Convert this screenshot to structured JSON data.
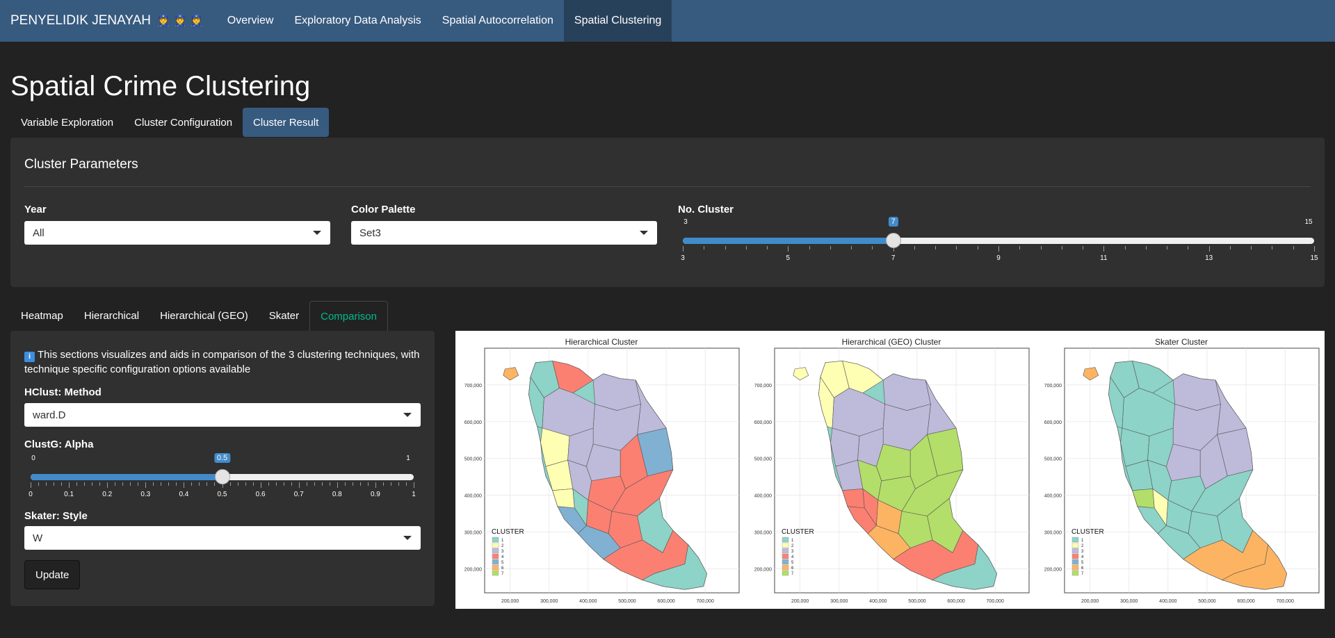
{
  "navbar": {
    "brand": "PENYELIDIK JENAYAH",
    "brand_icons": "👮👮👮",
    "items": [
      "Overview",
      "Exploratory Data Analysis",
      "Spatial Autocorrelation",
      "Spatial Clustering"
    ],
    "active": "Spatial Clustering"
  },
  "page_title": "Spatial Crime Clustering",
  "sub_tabs": {
    "items": [
      "Variable Exploration",
      "Cluster Configuration",
      "Cluster Result"
    ],
    "active": "Cluster Result"
  },
  "cluster_params": {
    "title": "Cluster Parameters",
    "year_label": "Year",
    "year_value": "All",
    "palette_label": "Color Palette",
    "palette_value": "Set3",
    "ncluster_label": "No. Cluster",
    "ncluster": {
      "min": 3,
      "max": 15,
      "value": 7,
      "ticks": [
        "3",
        "5",
        "7",
        "9",
        "11",
        "13",
        "15"
      ]
    }
  },
  "vis_tabs": {
    "items": [
      "Heatmap",
      "Hierarchical",
      "Hierarchical (GEO)",
      "Skater",
      "Comparison"
    ],
    "active": "Comparison"
  },
  "comparison": {
    "info_icon": "i",
    "info_text": "This sections visualizes and aids in comparison of the 3 clustering techniques, with technique specific configuration options available",
    "hclust_label": "HClust: Method",
    "hclust_value": "ward.D",
    "alpha_label": "ClustG: Alpha",
    "alpha": {
      "min": 0,
      "max": 1,
      "value": 0.5,
      "ticks": [
        "0",
        "0.1",
        "0.2",
        "0.3",
        "0.4",
        "0.5",
        "0.6",
        "0.7",
        "0.8",
        "0.9",
        "1"
      ]
    },
    "skater_label": "Skater: Style",
    "skater_value": "W",
    "update_label": "Update"
  },
  "maps": {
    "titles": [
      "Hierarchical Cluster",
      "Hierarchical (GEO) Cluster",
      "Skater Cluster"
    ],
    "legend_title": "CLUSTER",
    "legend_items": [
      "1",
      "2",
      "3",
      "4",
      "5",
      "6",
      "7"
    ],
    "palette": [
      "#8dd3c7",
      "#ffffb3",
      "#bebada",
      "#fb8072",
      "#80b1d3",
      "#fdb462",
      "#b3de69"
    ],
    "y_ticks": [
      "700,000",
      "600,000",
      "500,000",
      "400,000",
      "300,000",
      "200,000"
    ],
    "x_ticks": [
      "200,000",
      "300,000",
      "400,000",
      "500,000",
      "600,000",
      "700,000"
    ]
  }
}
